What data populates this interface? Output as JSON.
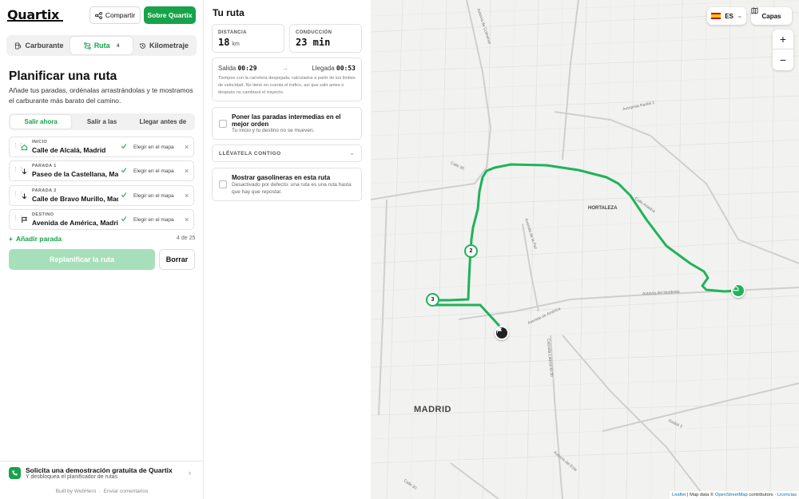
{
  "header": {
    "logo": "Quartix",
    "share_label": "Compartir",
    "about_label": "Sobre Quartix"
  },
  "tabs": [
    {
      "label": "Carburante",
      "icon": "fuel-icon"
    },
    {
      "label": "Ruta",
      "icon": "route-icon",
      "badge": "4"
    },
    {
      "label": "Kilometraje",
      "icon": "history-icon"
    }
  ],
  "planner": {
    "title": "Planificar una ruta",
    "description": "Añade tus paradas, ordénalas arrastrándolas y te mostramos el carburante más barato del camino.",
    "time_options": [
      "Salir ahora",
      "Salir a las",
      "Llegar antes de"
    ],
    "stops": [
      {
        "label": "INICIO",
        "name": "Calle de Alcalá, Madrid",
        "icon": "home-icon"
      },
      {
        "label": "PARADA 1",
        "name": "Paseo de la Castellana, Madrid",
        "icon": "arrow-down-icon"
      },
      {
        "label": "PARADA 2",
        "name": "Calle de Bravo Murillo, Madrid",
        "icon": "arrow-down-icon"
      },
      {
        "label": "DESTINO",
        "name": "Avenida de América, Madrid",
        "icon": "flag-icon"
      }
    ],
    "pick_on_map": "Elegir en el mapa",
    "add_stop": "Añadir parada",
    "count": "4 de 25",
    "replan": "Replanificar la ruta",
    "clear": "Borrar"
  },
  "demo": {
    "title": "Solicita una demostración gratuita de Quartix",
    "subtitle": "Y desbloquea el planificador de rutas"
  },
  "footer": {
    "built_by": "Built by WebHero",
    "feedback": "Enviar comentarios"
  },
  "route": {
    "title": "Tu ruta",
    "distance_label": "DISTANCIA",
    "distance_value": "18",
    "distance_unit": "km",
    "driving_label": "CONDUCCIÓN",
    "driving_value": "23 min",
    "departure_label": "Salida",
    "departure_time": "00:29",
    "arrival_label": "Llegada",
    "arrival_time": "00:53",
    "note": "Tiempos con la carretera despejada, calculados a partir de los límites de velocidad. No tiene en cuenta el tráfico, así que salir antes o después no cambiará el trayecto.",
    "optimize_title": "Poner las paradas intermedias en el mejor orden",
    "optimize_sub": "Tu inicio y tu destino no se mueven.",
    "take_along": "LLÉVATELA CONTIGO",
    "stations_title": "Mostrar gasolineras en esta ruta",
    "stations_sub": "Desactivado por defecto: una ruta es una ruta hasta que hay que repostar."
  },
  "map": {
    "language": "ES",
    "layers": "Capas",
    "zoom_in": "+",
    "zoom_out": "−",
    "city_label": "MADRID",
    "district_label": "HORTALEZA",
    "street_labels": [
      "Autovía de Colmenar",
      "Autopista Radial 2",
      "Calle 30",
      "Calle Ariadna",
      "Avenida de la Paz",
      "Autovía del Nordeste",
      "Avenida de América",
      "Calzada Lateral M-30",
      "Radial 3",
      "Autovía del Este",
      "Calle 30"
    ],
    "marker_2": "2",
    "marker_3": "3",
    "attribution_leaflet": "Leaflet",
    "attribution_text": "| Map data ©",
    "attribution_osm": "OpenStreetMap",
    "attribution_contrib": "contributors ·",
    "attribution_license": "Licencias",
    "route_color": "#1fb35a"
  }
}
